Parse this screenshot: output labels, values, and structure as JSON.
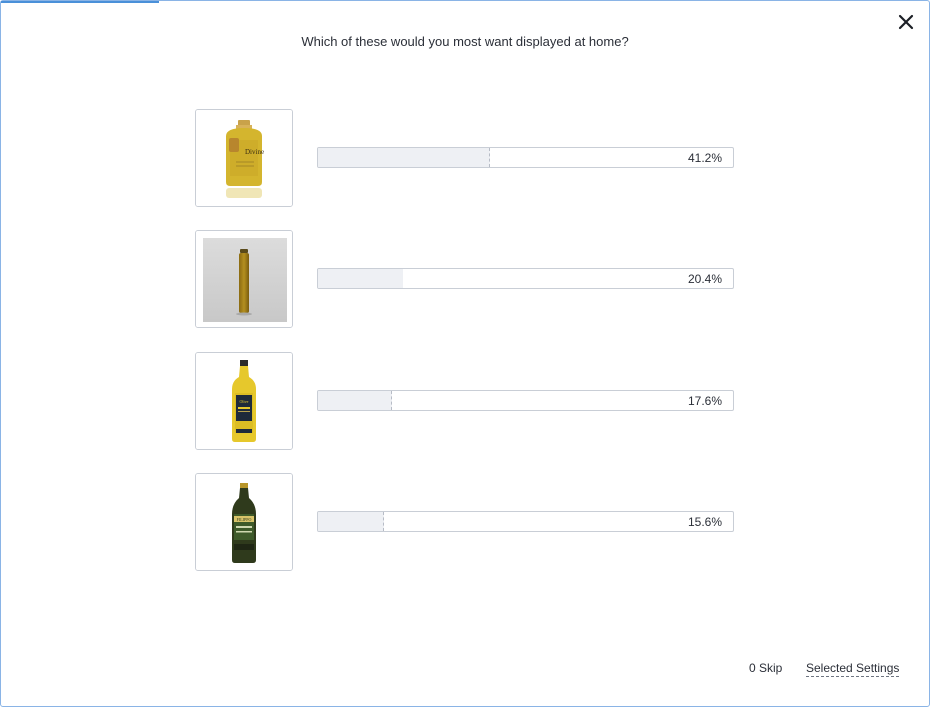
{
  "question": "Which of these would you most want displayed at home?",
  "progress_fraction": 0.17,
  "close_icon": "close-icon",
  "options": [
    {
      "image": "divine-olive-oil-bottle-image",
      "percent_label": "41.2%",
      "percent": 41.2
    },
    {
      "image": "tall-slim-oil-bottle-image",
      "percent_label": "20.4%",
      "percent": 20.4
    },
    {
      "image": "yellow-label-olive-oil-bottle-image",
      "percent_label": "17.6%",
      "percent": 17.6
    },
    {
      "image": "dark-green-olive-oil-bottle-image",
      "percent_label": "15.6%",
      "percent": 15.6
    }
  ],
  "footer": {
    "skip_label": "0 Skip",
    "settings_label": "Selected Settings"
  },
  "colors": {
    "accent": "#4a90d9",
    "bar_fill": "#eef0f4",
    "border": "#c9ced6"
  }
}
